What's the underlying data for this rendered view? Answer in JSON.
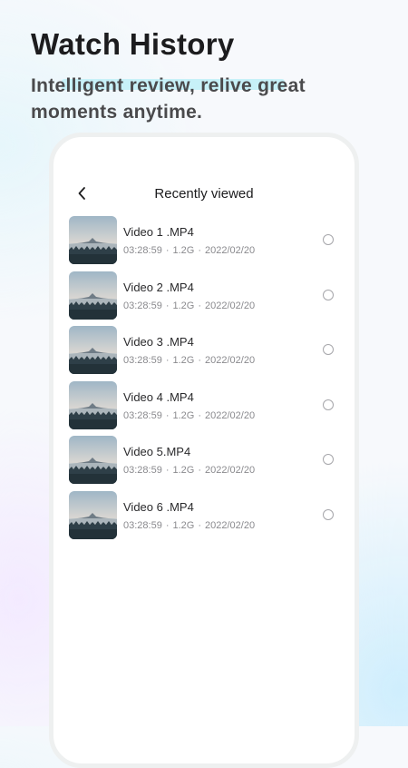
{
  "promo": {
    "headline": "Watch History",
    "subtitle": "Intelligent review, relive great moments anytime."
  },
  "screen": {
    "header_title": "Recently viewed",
    "back_icon": "chevron-left-icon",
    "videos": [
      {
        "title": "Video 1 .MP4",
        "duration": "03:28:59",
        "size": "1.2G",
        "date": "2022/02/20",
        "selected": false
      },
      {
        "title": "Video 2 .MP4",
        "duration": "03:28:59",
        "size": "1.2G",
        "date": "2022/02/20",
        "selected": false
      },
      {
        "title": "Video 3 .MP4",
        "duration": "03:28:59",
        "size": "1.2G",
        "date": "2022/02/20",
        "selected": false
      },
      {
        "title": "Video 4 .MP4",
        "duration": "03:28:59",
        "size": "1.2G",
        "date": "2022/02/20",
        "selected": false
      },
      {
        "title": "Video 5.MP4",
        "duration": "03:28:59",
        "size": "1.2G",
        "date": "2022/02/20",
        "selected": false
      },
      {
        "title": "Video 6 .MP4",
        "duration": "03:28:59",
        "size": "1.2G",
        "date": "2022/02/20",
        "selected": false
      }
    ],
    "meta_separator": "·"
  },
  "colors": {
    "highlight": "#c7f1f8",
    "text_primary": "#1c1c1e",
    "text_secondary": "#8a8a8e"
  }
}
